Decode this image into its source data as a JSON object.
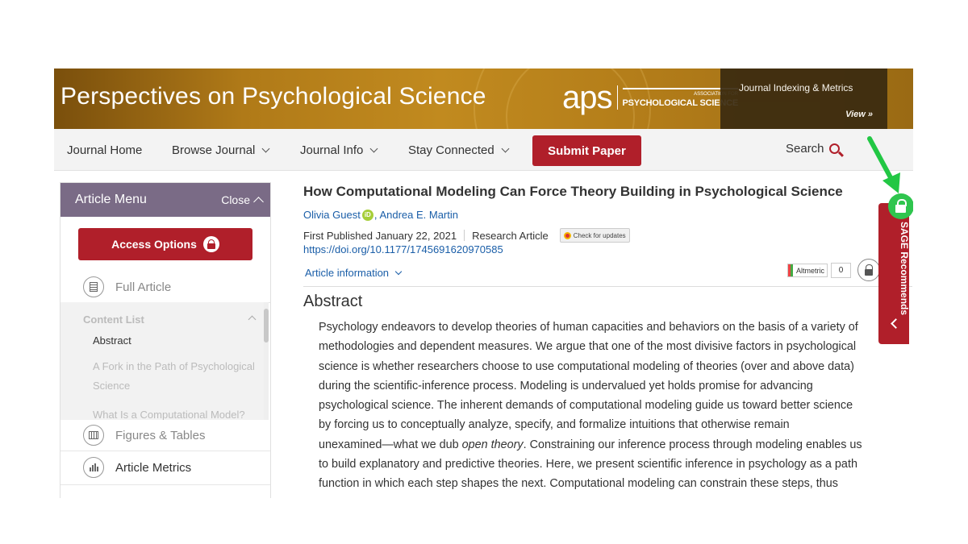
{
  "banner": {
    "journal_title": "Perspectives on Psychological Science",
    "logo_text": "aps",
    "logo_sub_small": "ASSOCIATION FOR",
    "logo_sub_main": "PSYCHOLOGICAL SCIENCE",
    "metrics_title": "Journal Indexing & Metrics",
    "metrics_view": "View »"
  },
  "nav": {
    "journal_home": "Journal Home",
    "browse_journal": "Browse Journal",
    "journal_info": "Journal Info",
    "stay_connected": "Stay Connected",
    "submit_paper": "Submit Paper",
    "search": "Search"
  },
  "sidebar": {
    "menu_title": "Article Menu",
    "close_label": "Close",
    "access_options": "Access Options",
    "full_article": "Full Article",
    "content_list_heading": "Content List",
    "content_items": [
      "Abstract",
      "A Fork in the Path of Psychological",
      "Science",
      "What Is a Computational Model?"
    ],
    "figures_tables": "Figures & Tables",
    "article_metrics": "Article Metrics"
  },
  "article": {
    "title": "How Computational Modeling Can Force Theory Building in Psychological Science",
    "author1": "Olivia Guest",
    "orcid_mark": "iD",
    "author_sep": ",",
    "author2": "Andrea E. Martin",
    "published": "First Published January 22, 2021",
    "type": "Research Article",
    "check_updates": "Check for updates",
    "doi": "https://doi.org/10.1177/1745691620970585",
    "article_information": "Article information",
    "altmetric_label": "Altmetric",
    "altmetric_count": "0",
    "abstract_heading": "Abstract",
    "abstract_lines": [
      "Psychology endeavors to develop theories of human capacities and behaviors on the basis of a variety of",
      "methodologies and dependent measures. We argue that one of the most divisive factors in psychological",
      "science is whether researchers choose to use computational modeling of theories (over and above data)",
      "during the scientific-inference process. Modeling is undervalued yet holds promise for advancing",
      "psychological science. The inherent demands of computational modeling guide us toward better science",
      "by forcing us to conceptually analyze, specify, and formalize intuitions that otherwise remain"
    ],
    "abstract_line7_pre": "unexamined—what we dub ",
    "abstract_line7_em": "open theory",
    "abstract_line7_post": ". Constraining our inference process through modeling enables us",
    "abstract_lines_end": [
      "to build explanatory and predictive theories. Here, we present scientific inference in psychology as a path",
      "function in which each step shapes the next. Computational modeling can constrain these steps, thus"
    ]
  },
  "sage_tab": {
    "label": "SAGE Recommends"
  },
  "colors": {
    "brand_red": "#b01f2a",
    "menu_purple": "#7a6b86",
    "link_blue": "#1a5ea8",
    "unlock_green": "#2fc54e",
    "banner_gold": "#c18a1f"
  },
  "icons": {
    "search": "search-icon",
    "lock": "lock-icon",
    "unlock": "unlock-icon",
    "full_article": "document-icon",
    "figures": "table-icon",
    "metrics": "bar-chart-icon",
    "annotation": "green-arrow-icon"
  }
}
